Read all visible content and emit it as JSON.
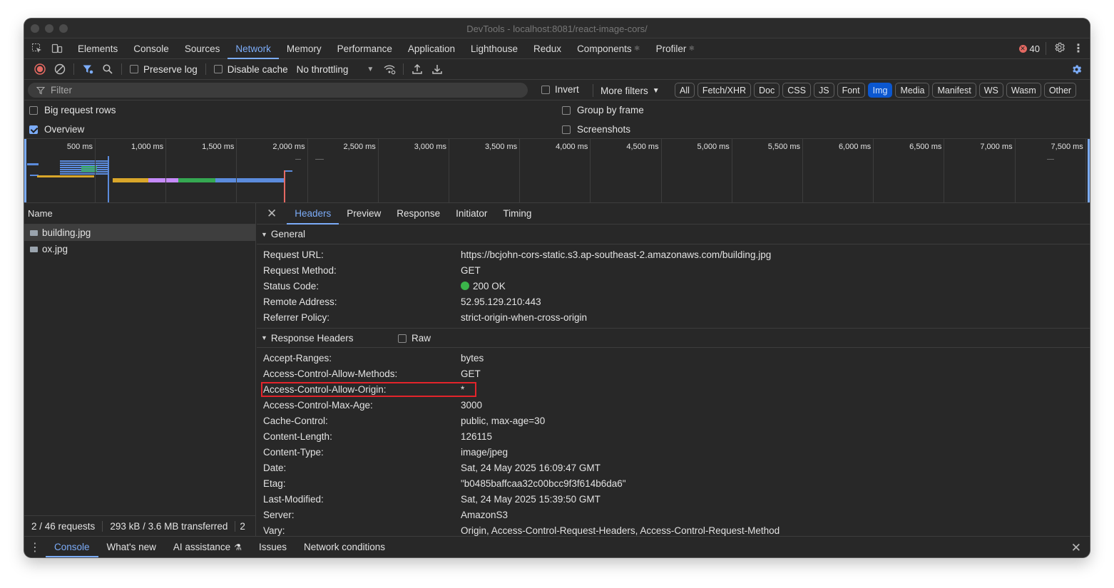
{
  "window": {
    "title": "DevTools - localhost:8081/react-image-cors/"
  },
  "main_tabs": [
    {
      "label": "Elements",
      "active": false,
      "gear": false
    },
    {
      "label": "Console",
      "active": false,
      "gear": false
    },
    {
      "label": "Sources",
      "active": false,
      "gear": false
    },
    {
      "label": "Network",
      "active": true,
      "gear": false
    },
    {
      "label": "Memory",
      "active": false,
      "gear": false
    },
    {
      "label": "Performance",
      "active": false,
      "gear": false
    },
    {
      "label": "Application",
      "active": false,
      "gear": false
    },
    {
      "label": "Lighthouse",
      "active": false,
      "gear": false
    },
    {
      "label": "Redux",
      "active": false,
      "gear": false
    },
    {
      "label": "Components",
      "active": false,
      "gear": true
    },
    {
      "label": "Profiler",
      "active": false,
      "gear": true
    }
  ],
  "errors": {
    "count": "40"
  },
  "toolbar": {
    "preserve_log": "Preserve log",
    "disable_cache": "Disable cache",
    "throttling": "No throttling"
  },
  "filter": {
    "placeholder": "Filter",
    "invert": "Invert",
    "more_filters": "More filters",
    "types": [
      {
        "label": "All",
        "active": false
      },
      {
        "label": "Fetch/XHR",
        "active": false
      },
      {
        "label": "Doc",
        "active": false
      },
      {
        "label": "CSS",
        "active": false
      },
      {
        "label": "JS",
        "active": false
      },
      {
        "label": "Font",
        "active": false
      },
      {
        "label": "Img",
        "active": true
      },
      {
        "label": "Media",
        "active": false
      },
      {
        "label": "Manifest",
        "active": false
      },
      {
        "label": "WS",
        "active": false
      },
      {
        "label": "Wasm",
        "active": false
      },
      {
        "label": "Other",
        "active": false
      }
    ]
  },
  "settings": {
    "big_request_rows": {
      "label": "Big request rows",
      "checked": false
    },
    "overview": {
      "label": "Overview",
      "checked": true
    },
    "group_by_frame": {
      "label": "Group by frame",
      "checked": false
    },
    "screenshots": {
      "label": "Screenshots",
      "checked": false
    }
  },
  "overview": {
    "ticks": [
      "500 ms",
      "1,000 ms",
      "1,500 ms",
      "2,000 ms",
      "2,500 ms",
      "3,000 ms",
      "3,500 ms",
      "4,000 ms",
      "4,500 ms",
      "5,000 ms",
      "5,500 ms",
      "6,000 ms",
      "6,500 ms",
      "7,000 ms",
      "7,500 ms"
    ]
  },
  "requests": {
    "header": "Name",
    "items": [
      {
        "name": "building.jpg",
        "selected": true
      },
      {
        "name": "ox.jpg",
        "selected": false
      }
    ],
    "status": {
      "requests": "2 / 46 requests",
      "transferred": "293 kB / 3.6 MB transferred",
      "overflow": "2"
    }
  },
  "details": {
    "tabs": [
      {
        "label": "Headers",
        "active": true
      },
      {
        "label": "Preview",
        "active": false
      },
      {
        "label": "Response",
        "active": false
      },
      {
        "label": "Initiator",
        "active": false
      },
      {
        "label": "Timing",
        "active": false
      }
    ],
    "general": {
      "title": "General",
      "rows": [
        {
          "key": "Request URL:",
          "value": "https://bcjohn-cors-static.s3.ap-southeast-2.amazonaws.com/building.jpg"
        },
        {
          "key": "Request Method:",
          "value": "GET"
        },
        {
          "key": "Status Code:",
          "value": "200 OK",
          "status_color": "#3bb44a"
        },
        {
          "key": "Remote Address:",
          "value": "52.95.129.210:443"
        },
        {
          "key": "Referrer Policy:",
          "value": "strict-origin-when-cross-origin"
        }
      ]
    },
    "response_headers": {
      "title": "Response Headers",
      "raw_label": "Raw",
      "rows": [
        {
          "key": "Accept-Ranges:",
          "value": "bytes"
        },
        {
          "key": "Access-Control-Allow-Methods:",
          "value": "GET"
        },
        {
          "key": "Access-Control-Allow-Origin:",
          "value": "*",
          "highlighted": true
        },
        {
          "key": "Access-Control-Max-Age:",
          "value": "3000"
        },
        {
          "key": "Cache-Control:",
          "value": "public, max-age=30"
        },
        {
          "key": "Content-Length:",
          "value": "126115"
        },
        {
          "key": "Content-Type:",
          "value": "image/jpeg"
        },
        {
          "key": "Date:",
          "value": "Sat, 24 May 2025 16:09:47 GMT"
        },
        {
          "key": "Etag:",
          "value": "\"b0485baffcaa32c00bcc9f3f614b6da6\""
        },
        {
          "key": "Last-Modified:",
          "value": "Sat, 24 May 2025 15:39:50 GMT"
        },
        {
          "key": "Server:",
          "value": "AmazonS3"
        },
        {
          "key": "Vary:",
          "value": "Origin, Access-Control-Request-Headers, Access-Control-Request-Method"
        }
      ]
    }
  },
  "drawer": {
    "tabs": [
      {
        "label": "Console",
        "active": true
      },
      {
        "label": "What's new",
        "active": false
      },
      {
        "label": "AI assistance",
        "active": false,
        "flask": true
      },
      {
        "label": "Issues",
        "active": false
      },
      {
        "label": "Network conditions",
        "active": false
      }
    ]
  },
  "colors": {
    "accent": "#7cacf8",
    "record": "#e46962",
    "highlight_box": "#e3242b",
    "status_ok": "#3bb44a",
    "active_pill": "#0b57d0"
  }
}
